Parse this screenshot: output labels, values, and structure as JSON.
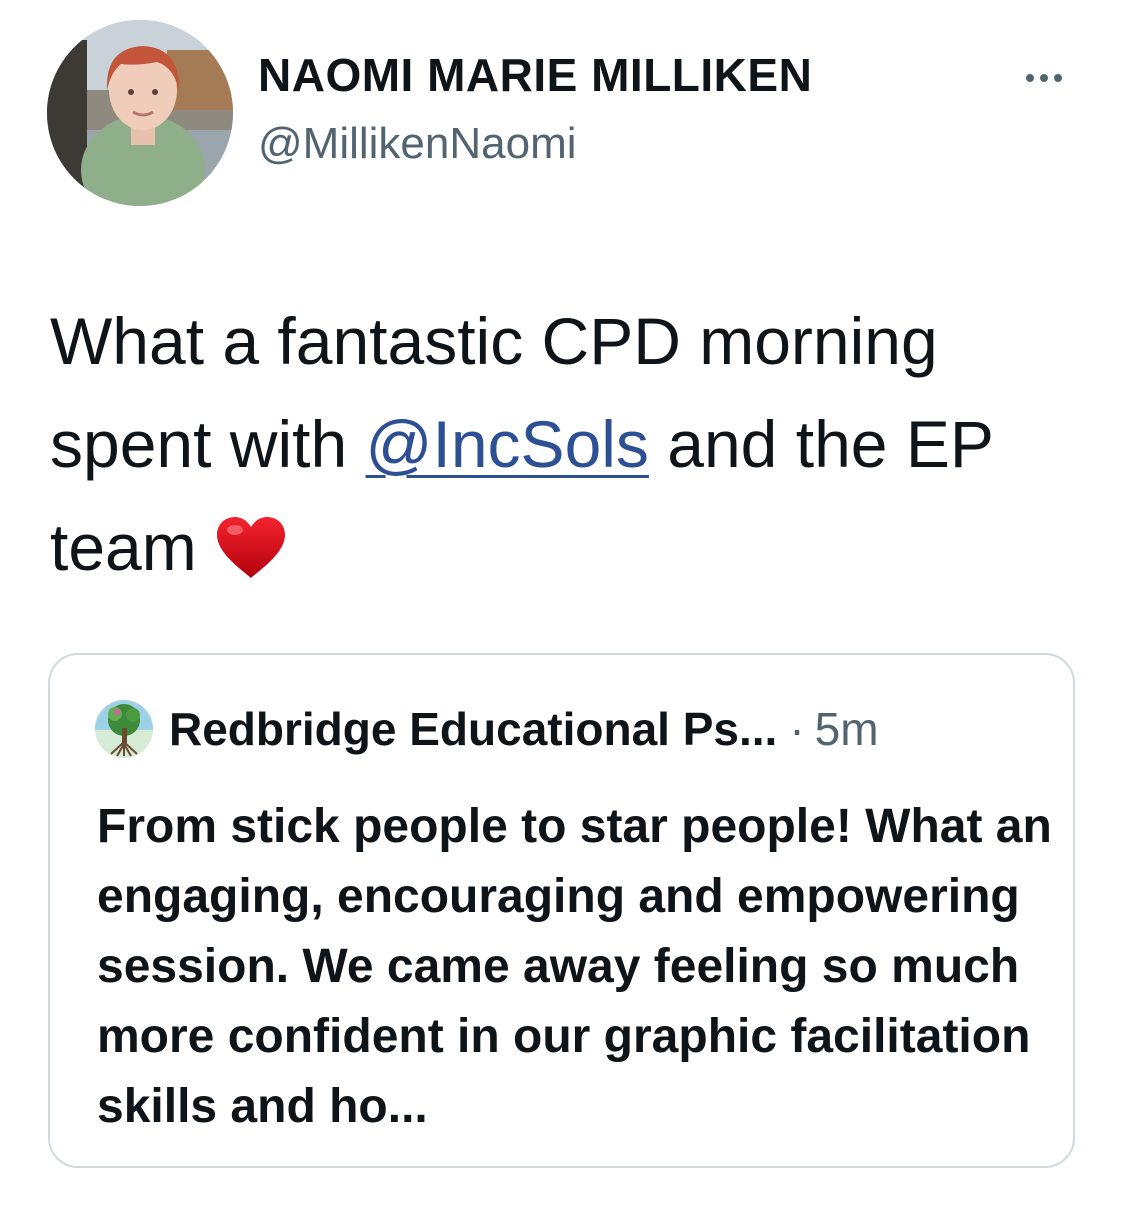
{
  "author": {
    "display_name": "NAOMI MARIE MILLIKEN",
    "handle": "@MillikenNaomi"
  },
  "tweet": {
    "text_before": "What a fantastic CPD morning spent with ",
    "mention": "@IncSols",
    "text_after": " and the EP team",
    "emoji": "heart-emoji"
  },
  "quoted_tweet": {
    "author": "Redbridge Educational Ps...",
    "separator": "·",
    "time": "5m",
    "text": "From stick people to star people! What an engaging, encouraging and empowering session. We came away feeling so much more confident in our graphic facilitation skills and ho..."
  },
  "icons": {
    "more": "more-options-icon"
  },
  "colors": {
    "text": "#0f1419",
    "secondary": "#536471",
    "link": "#2d4f94",
    "border": "#cfd9de",
    "heart": "#d7081c"
  }
}
